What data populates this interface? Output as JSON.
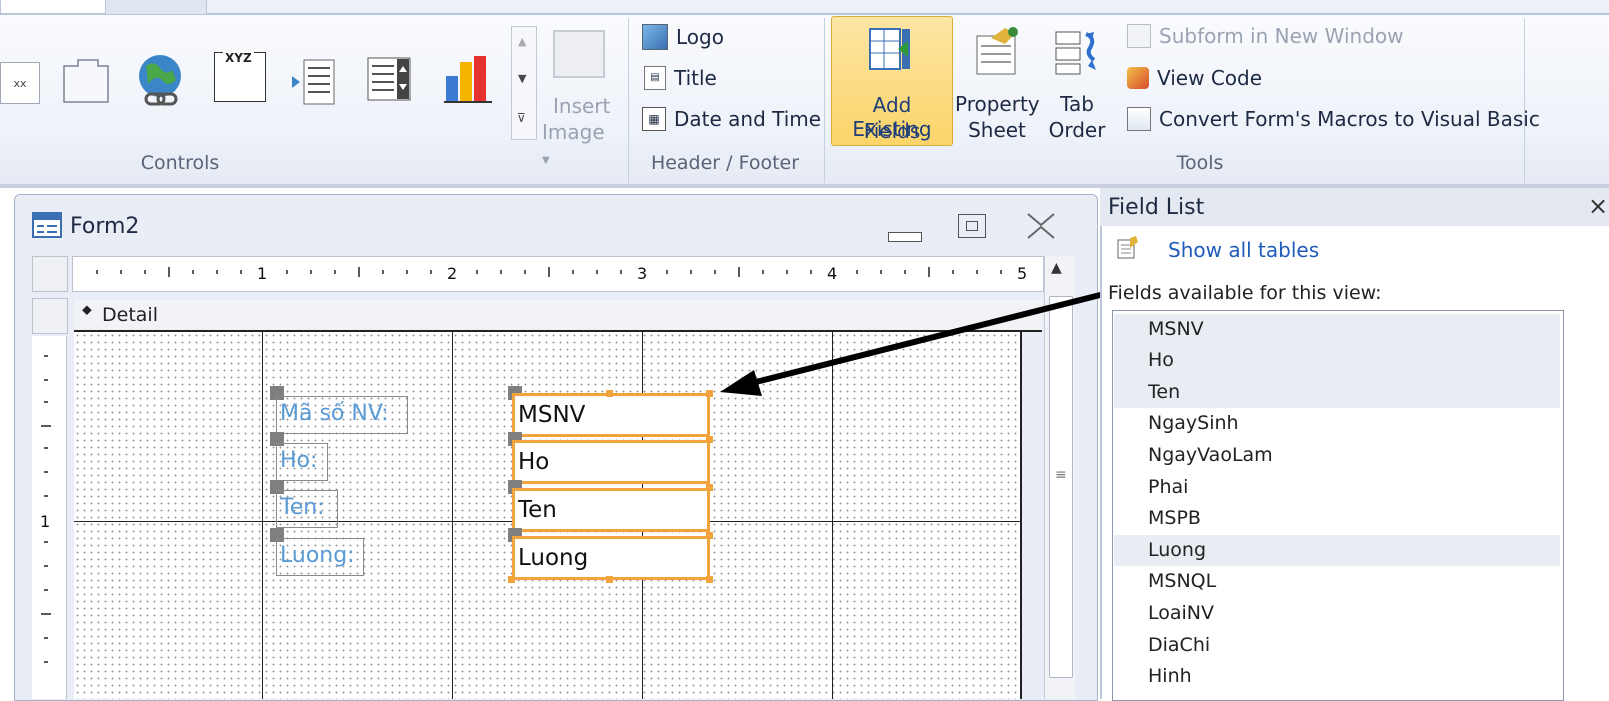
{
  "ribbon": {
    "controls_group_label": "Controls",
    "insert_image_label_1": "Insert",
    "insert_image_label_2": "Image",
    "header_footer": {
      "group_label": "Header / Footer",
      "logo": "Logo",
      "title": "Title",
      "date_time": "Date and Time"
    },
    "tools": {
      "group_label": "Tools",
      "add_existing_1": "Add Existing",
      "add_existing_2": "Fields",
      "property_1": "Property",
      "property_2": "Sheet",
      "tab_order_1": "Tab",
      "tab_order_2": "Order",
      "subform": "Subform in New Window",
      "view_code": "View Code",
      "convert_macros": "Convert Form's Macros to Visual Basic"
    },
    "xyz_label": "XYZ",
    "truncated_icon_text": "xx"
  },
  "form_window": {
    "title": "Form2",
    "section": "Detail",
    "ruler_numbers": [
      "1",
      "2",
      "3",
      "4",
      "5"
    ],
    "vruler_number": "1",
    "labels": [
      "Mã số NV:",
      "Ho:",
      "Ten:",
      "Luong:"
    ],
    "fields": [
      "MSNV",
      "Ho",
      "Ten",
      "Luong"
    ]
  },
  "field_list": {
    "title": "Field List",
    "close": "×",
    "show_all_tables": "Show all tables",
    "caption": "Fields available for this view:",
    "items": [
      "MSNV",
      "Ho",
      "Ten",
      "NgaySinh",
      "NgayVaoLam",
      "Phai",
      "MSPB",
      "Luong",
      "MSNQL",
      "LoaiNV",
      "DiaChi",
      "Hinh"
    ]
  },
  "colors": {
    "selection_orange": "#f2a33c",
    "label_blue": "#5b9bd5",
    "link_blue": "#1f5bb8",
    "highlight_yellow": "#fbd968"
  }
}
